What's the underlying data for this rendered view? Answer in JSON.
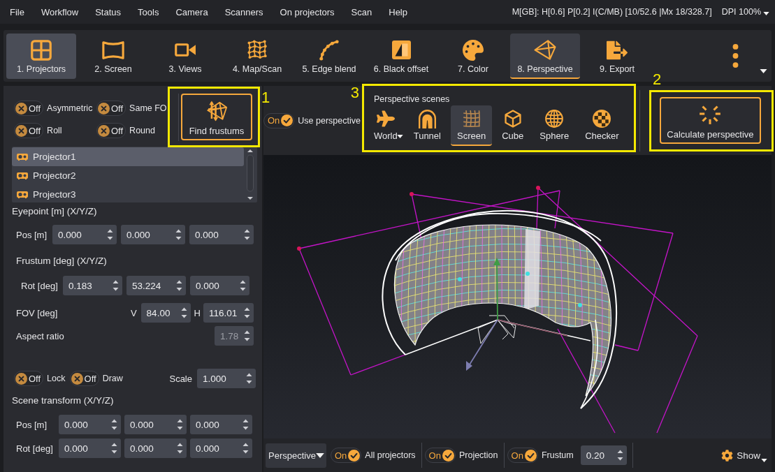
{
  "menu_bar": {
    "items": [
      "File",
      "Workflow",
      "Status",
      "Tools",
      "Camera",
      "Scanners",
      "On projectors",
      "Scan",
      "Help"
    ],
    "memory_status": "M[GB]: H[0.6] P[0.2] I(C/MB) [10/52.6 |Mx 18/328.7]",
    "dpi": "DPI 100%"
  },
  "toolbar": {
    "items": [
      {
        "label": "1. Projectors",
        "selected": false,
        "hovered": true
      },
      {
        "label": "2. Screen",
        "selected": false,
        "hovered": false
      },
      {
        "label": "3. Views",
        "selected": false,
        "hovered": false
      },
      {
        "label": "4. Map/Scan",
        "selected": false,
        "hovered": false
      },
      {
        "label": "5. Edge blend",
        "selected": false,
        "hovered": false
      },
      {
        "label": "6. Black offset",
        "selected": false,
        "hovered": false
      },
      {
        "label": "7. Color",
        "selected": false,
        "hovered": false
      },
      {
        "label": "8. Perspective",
        "selected": true,
        "hovered": false
      },
      {
        "label": "9. Export",
        "selected": false,
        "hovered": false
      }
    ]
  },
  "frustum_options": {
    "toggles": [
      {
        "state_text": "Off",
        "on": false,
        "label": "Asymmetric"
      },
      {
        "state_text": "Off",
        "on": false,
        "label": "Same FO"
      },
      {
        "state_text": "Off",
        "on": false,
        "label": "Roll"
      },
      {
        "state_text": "Off",
        "on": false,
        "label": "Round"
      }
    ],
    "find_button": {
      "label": "Find frustums",
      "callout": "1"
    }
  },
  "projectors": [
    {
      "name": "Projector1",
      "selected": true
    },
    {
      "name": "Projector2",
      "selected": false
    },
    {
      "name": "Projector3",
      "selected": false
    }
  ],
  "eyepoint": {
    "title": "Eyepoint [m] (X/Y/Z)",
    "pos": {
      "label": "Pos [m]",
      "values": [
        "0.000",
        "0.000",
        "0.000"
      ]
    }
  },
  "frustum": {
    "title": "Frustum [deg] (X/Y/Z)",
    "rot": {
      "label": "Rot [deg]",
      "values": [
        "0.183",
        "53.224",
        "0.000"
      ]
    },
    "fov": {
      "label": "FOV [deg]",
      "v_label": "V",
      "v": "84.00",
      "h_label": "H",
      "h": "116.01"
    },
    "aspect": {
      "label": "Aspect ratio",
      "value": "1.78",
      "disabled": true
    }
  },
  "scene_options": {
    "toggles": [
      {
        "state_text": "Off",
        "on": false,
        "label": "Lock"
      },
      {
        "state_text": "Off",
        "on": false,
        "label": "Draw"
      }
    ],
    "scale_label": "Scale",
    "scale": "1.000"
  },
  "scene_transform": {
    "title": "Scene transform (X/Y/Z)",
    "pos": {
      "label": "Pos [m]",
      "values": [
        "0.000",
        "0.000",
        "0.000"
      ]
    },
    "rot": {
      "label": "Rot [deg]",
      "values": [
        "0.000",
        "0.000",
        "0.000"
      ]
    }
  },
  "use_perspective": {
    "state_text": "On",
    "on": true,
    "label": "Use perspective"
  },
  "perspective_scenes": {
    "title": "Perspective scenes",
    "callout": "3",
    "items": [
      {
        "label": "World",
        "selected": false,
        "dropdown": true
      },
      {
        "label": "Tunnel",
        "selected": false,
        "dropdown": false
      },
      {
        "label": "Screen",
        "selected": true,
        "dropdown": false
      },
      {
        "label": "Cube",
        "selected": false,
        "dropdown": false
      },
      {
        "label": "Sphere",
        "selected": false,
        "dropdown": false
      },
      {
        "label": "Checker",
        "selected": false,
        "dropdown": false
      }
    ]
  },
  "calculate": {
    "label": "Calculate perspective",
    "callout": "2"
  },
  "view_bar": {
    "mode": "Perspective",
    "toggles": [
      {
        "state_text": "On",
        "on": true,
        "label": "All projectors"
      },
      {
        "state_text": "On",
        "on": true,
        "label": "Projection"
      },
      {
        "state_text": "On",
        "on": true,
        "label": "Frustum"
      }
    ],
    "frustum_size": "0.20",
    "show": "Show"
  }
}
